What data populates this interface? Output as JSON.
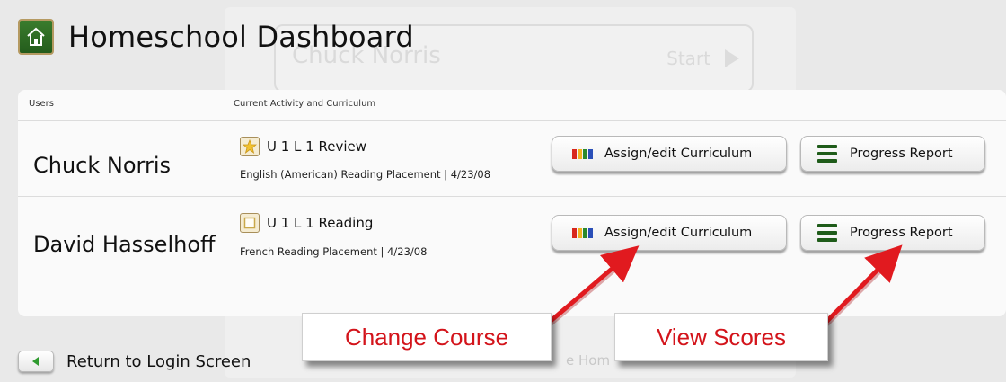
{
  "header": {
    "title": "Homeschool Dashboard",
    "icon": "house-icon"
  },
  "background": {
    "user_name": "Chuck Norris",
    "start_label": "Start",
    "home_label": "e Hom"
  },
  "table": {
    "col_users": "Users",
    "col_activity": "Current Activity and Curriculum"
  },
  "rows": [
    {
      "name": "Chuck Norris",
      "activity": "U 1 L 1 Review",
      "activity_icon": "star-icon",
      "curriculum": "English (American)  Reading Placement | 4/23/08",
      "assign_label": "Assign/edit Curriculum",
      "report_label": "Progress Report"
    },
    {
      "name": "David Hasselhoff",
      "activity": "U 1 L 1 Reading",
      "activity_icon": "square-icon",
      "curriculum": "French Reading Placement | 4/23/08",
      "assign_label": "Assign/edit Curriculum",
      "report_label": "Progress Report"
    }
  ],
  "annotations": {
    "change_course": "Change Course",
    "view_scores": "View Scores"
  },
  "footer": {
    "return_label": "Return to Login Screen"
  },
  "colors": {
    "accent_green": "#2a6b22",
    "annotation_red": "#d3141b",
    "arrow_red": "#e11a1f"
  }
}
